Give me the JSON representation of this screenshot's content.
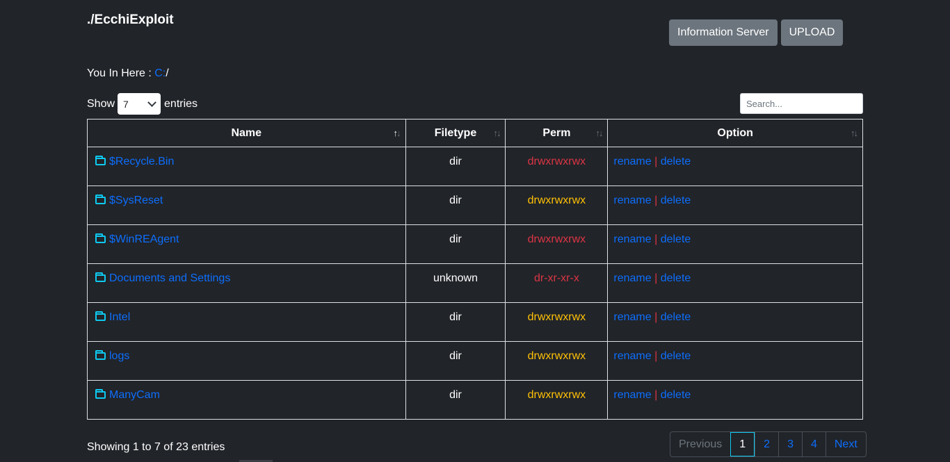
{
  "header": {
    "title": "./EcchiExploit",
    "info_button": "Information Server",
    "upload_button": "UPLOAD"
  },
  "path": {
    "label": "You In Here : ",
    "drive": "C:",
    "sep": "/"
  },
  "length": {
    "show": "Show",
    "value": "7",
    "entries": "entries"
  },
  "search": {
    "placeholder": "Search..."
  },
  "table": {
    "columns": [
      "Name",
      "Filetype",
      "Perm",
      "Option"
    ],
    "rows": [
      {
        "name": "$Recycle.Bin",
        "type": "dir",
        "perm": "drwxrwxrwx",
        "perm_color": "#dc3545"
      },
      {
        "name": "$SysReset",
        "type": "dir",
        "perm": "drwxrwxrwx",
        "perm_color": "#ffc107"
      },
      {
        "name": "$WinREAgent",
        "type": "dir",
        "perm": "drwxrwxrwx",
        "perm_color": "#dc3545"
      },
      {
        "name": "Documents and Settings",
        "type": "unknown",
        "perm": "dr-xr-xr-x",
        "perm_color": "#dc3545"
      },
      {
        "name": "Intel",
        "type": "dir",
        "perm": "drwxrwxrwx",
        "perm_color": "#ffc107"
      },
      {
        "name": "logs",
        "type": "dir",
        "perm": "drwxrwxrwx",
        "perm_color": "#ffc107"
      },
      {
        "name": "ManyCam",
        "type": "dir",
        "perm": "drwxrwxrwx",
        "perm_color": "#ffc107"
      }
    ],
    "option_rename": "rename",
    "option_sep": "|",
    "option_delete": "delete",
    "row_icon": "folder-icon"
  },
  "footer": {
    "info": "Showing 1 to 7 of 23 entries",
    "pagination": {
      "previous": "Previous",
      "pages": [
        "1",
        "2",
        "3",
        "4"
      ],
      "next": "Next",
      "current": "1"
    }
  },
  "colors": {
    "background": "#212429",
    "link": "#0d6efd",
    "danger": "#dc3545",
    "warning": "#ffc107",
    "folder": "#0dcaf0"
  }
}
